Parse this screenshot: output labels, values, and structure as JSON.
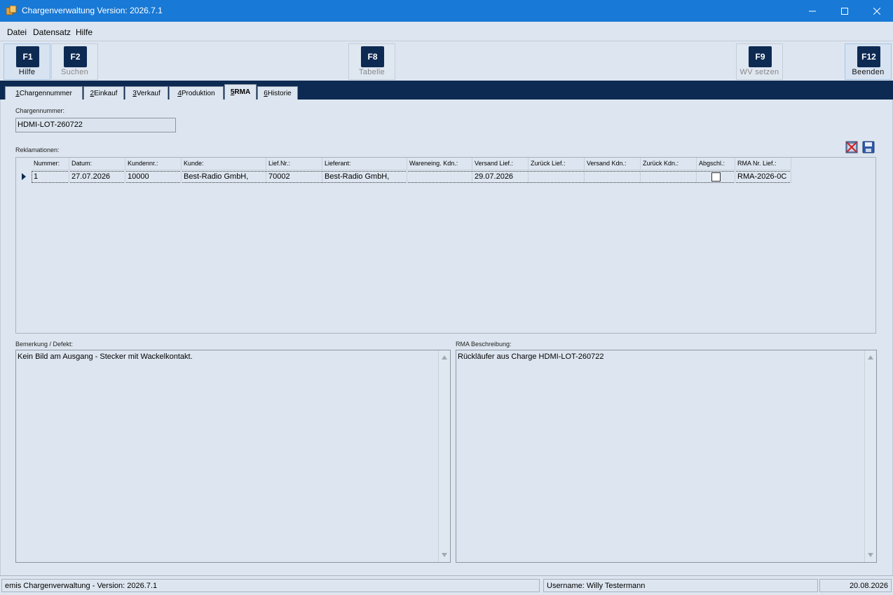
{
  "window": {
    "title": "Chargenverwaltung Version: 2026.7.1"
  },
  "menu": {
    "items": [
      "Datei",
      "Datensatz",
      "Hilfe"
    ]
  },
  "toolbar": {
    "buttons": [
      {
        "key": "F1",
        "label": "Hilfe"
      },
      {
        "key": "F2",
        "label": "Suchen"
      },
      {
        "key": "F8",
        "label": "Tabelle"
      },
      {
        "key": "F9",
        "label": "WV setzen"
      },
      {
        "key": "F12",
        "label": "Beenden"
      }
    ]
  },
  "tabs": [
    {
      "num": "1",
      "label": " Chargennummer"
    },
    {
      "num": "2",
      "label": " Einkauf"
    },
    {
      "num": "3",
      "label": " Verkauf"
    },
    {
      "num": "4",
      "label": " Produktion"
    },
    {
      "num": "5",
      "label": " RMA"
    },
    {
      "num": "6",
      "label": " Historie"
    }
  ],
  "charge": {
    "label": "Chargennummer:",
    "value": "HDMI-LOT-260722"
  },
  "reklamationen": {
    "label": "Reklamationen:",
    "columns": [
      "Nummer:",
      "Datum:",
      "Kundennr.:",
      "Kunde:",
      "Lief.Nr.:",
      "Lieferant:",
      "Wareneing. Kdn.:",
      "Versand Lief.:",
      "Zurück Lief.:",
      "Versand Kdn.:",
      "Zurück Kdn.:",
      "Abgschl.:",
      "RMA Nr. Lief.:"
    ],
    "rows": [
      [
        "1",
        "27.07.2026",
        "10000",
        "Best-Radio GmbH,",
        "70002",
        "Best-Radio GmbH,",
        "",
        "29.07.2026",
        "",
        "",
        "",
        "",
        "RMA-2026-0C"
      ]
    ]
  },
  "bemerkung": {
    "label": "Bemerkung / Defekt:",
    "text": "Kein Bild am Ausgang - Stecker mit Wackelkontakt."
  },
  "rma_beschreibung": {
    "label": "RMA Beschreibung:",
    "text": "Rückläufer aus Charge HDMI-LOT-260722"
  },
  "status": {
    "app": "emis Chargenverwaltung - Version: 2026.7.1",
    "user": "Username: Willy Testermann",
    "date": "20.08.2026"
  },
  "colors": {
    "titlebar": "#1979d6",
    "tabstrip": "#0d2a53",
    "panel": "#dde6f0"
  }
}
